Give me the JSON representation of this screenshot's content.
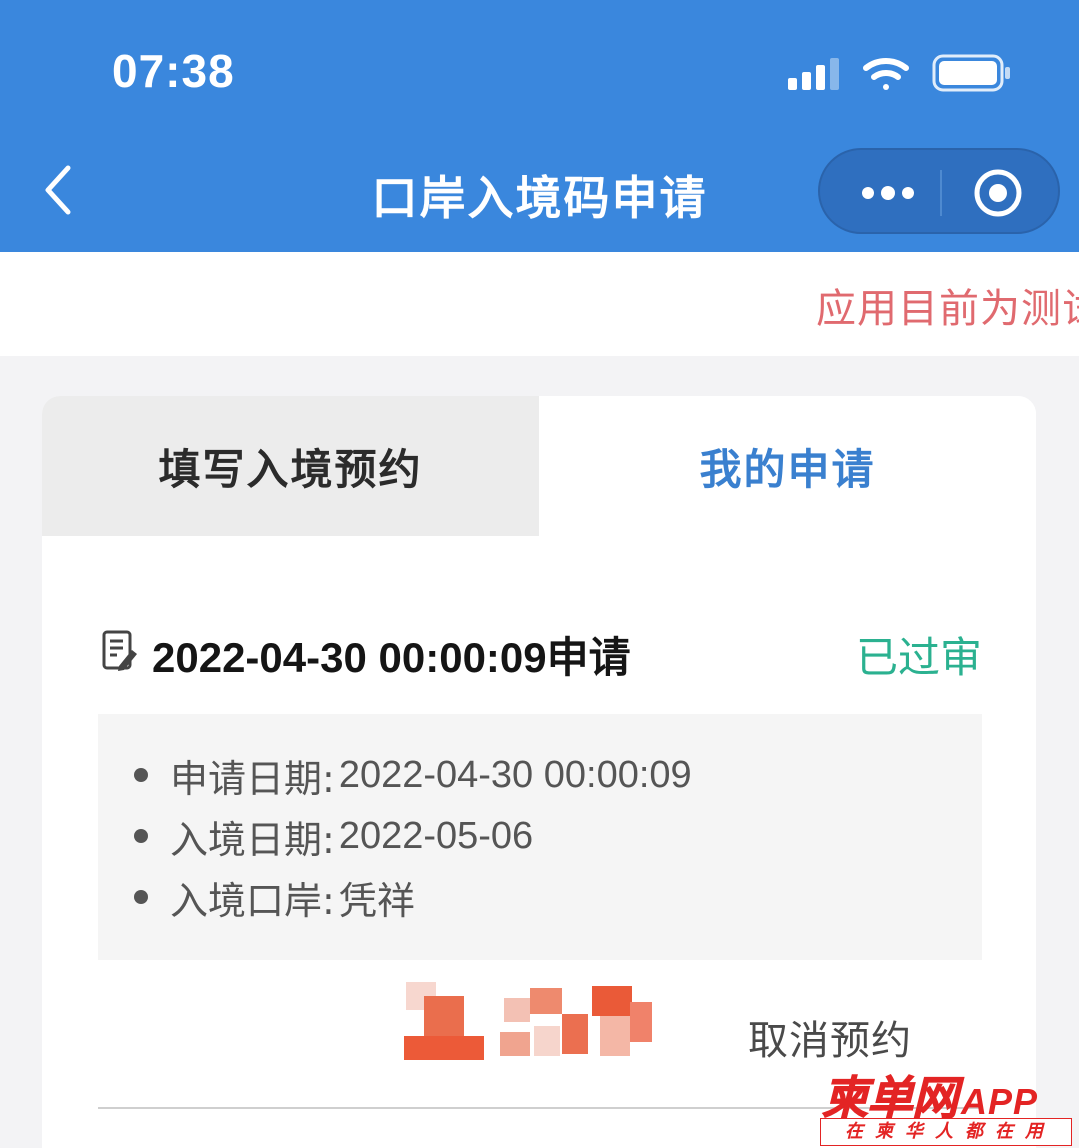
{
  "status_bar": {
    "time": "07:38"
  },
  "nav": {
    "title": "口岸入境码申请"
  },
  "notice": {
    "text": "应用目前为测试"
  },
  "tabs": [
    {
      "label": "填写入境预约",
      "active": false
    },
    {
      "label": "我的申请",
      "active": true
    }
  ],
  "application": {
    "title": "2022-04-30 00:00:09申请",
    "status": "已过审",
    "details": [
      {
        "label": "申请日期:",
        "value": "2022-04-30 00:00:09"
      },
      {
        "label": "入境日期:",
        "value": "2022-05-06"
      },
      {
        "label": "入境口岸:",
        "value": "凭祥"
      }
    ],
    "cancel_label": "取消预约"
  },
  "watermark": {
    "brand_cn": "柬单网",
    "brand_en": "APP",
    "slogan": "在柬华人都在用"
  },
  "colors": {
    "header_blue": "#3a87dd",
    "active_tab": "#3a80cf",
    "status_green": "#2bb190",
    "notice_red": "#e06a6f",
    "watermark_red": "#e32424"
  }
}
